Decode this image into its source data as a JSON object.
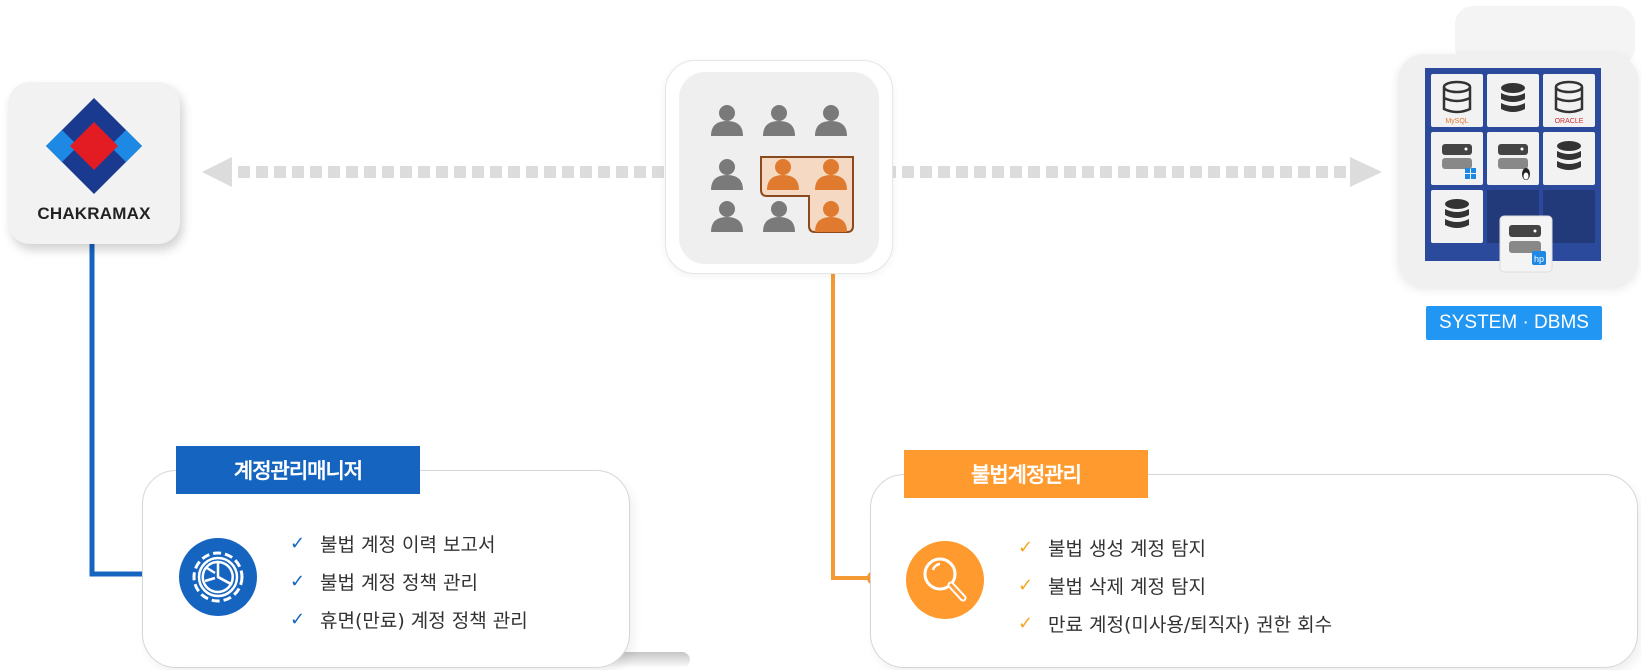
{
  "logo": {
    "name": "CHAKRA MAX",
    "text": "CHAKRAMAX",
    "icon": "chakramax-diamond-logo"
  },
  "center": {
    "icon": "user-group-icon",
    "highlight_icon": "suspicious-users-icon"
  },
  "dbms": {
    "label": "SYSTEM · DBMS",
    "icons": [
      "mysql-database-icon",
      "database-icon",
      "oracle-database-icon",
      "windows-server-icon",
      "linux-server-icon",
      "database-icon",
      "database-icon",
      "hp-server-icon"
    ],
    "db_logos": [
      "MySQL",
      "ORACLE"
    ]
  },
  "panels": {
    "left": {
      "title": "계정관리매니저",
      "icon": "gear-chart-icon",
      "items": [
        "불법 계정 이력 보고서",
        "불법 계정 정책 관리",
        "휴면(만료) 계정 정책 관리"
      ]
    },
    "right": {
      "title": "불법계정관리",
      "icon": "magnifier-icon",
      "items": [
        "불법 생성 계정 탐지",
        "불법 삭제 계정 탐지",
        "만료 계정(미사용/퇴직자) 권한 회수"
      ]
    }
  },
  "check_glyph": "✓",
  "colors": {
    "blue": "#1565c0",
    "orange": "#ff9a2e",
    "badge_blue": "#2196f3",
    "user_gray": "#7a7a7a",
    "user_orange": "#e07a2e",
    "dbms_panel": "#2b4a9b"
  }
}
